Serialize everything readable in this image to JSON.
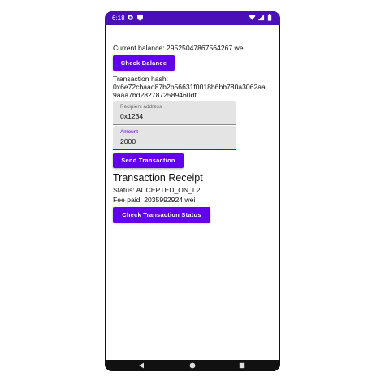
{
  "status_bar": {
    "time": "6:18"
  },
  "balance": {
    "text": "Current balance: 29525047867564267 wei",
    "button_label": "Check Balance"
  },
  "transaction": {
    "hash_label": "Transaction hash:",
    "hash_line1": "0x6e72cbaad87b2b56631f0018b6bb780a3062aa",
    "hash_line2": "9aaa7bd2827872589460df"
  },
  "form": {
    "recipient": {
      "label": "Recipient address",
      "value": "0x1234"
    },
    "amount": {
      "label": "Amount",
      "value": "2000"
    },
    "send_label": "Send Transaction"
  },
  "receipt": {
    "title": "Transaction Receipt",
    "status": "Status: ACCEPTED_ON_L2",
    "fee": "Fee paid: 2035992924 wei",
    "check_label": "Check Transaction Status"
  },
  "colors": {
    "primary": "#6200ee",
    "status_bar": "#4b0fb8"
  },
  "icons": [
    "settings-icon",
    "shield-icon",
    "wifi-icon",
    "signal-icon",
    "battery-icon",
    "back-icon",
    "home-icon",
    "recents-icon"
  ]
}
